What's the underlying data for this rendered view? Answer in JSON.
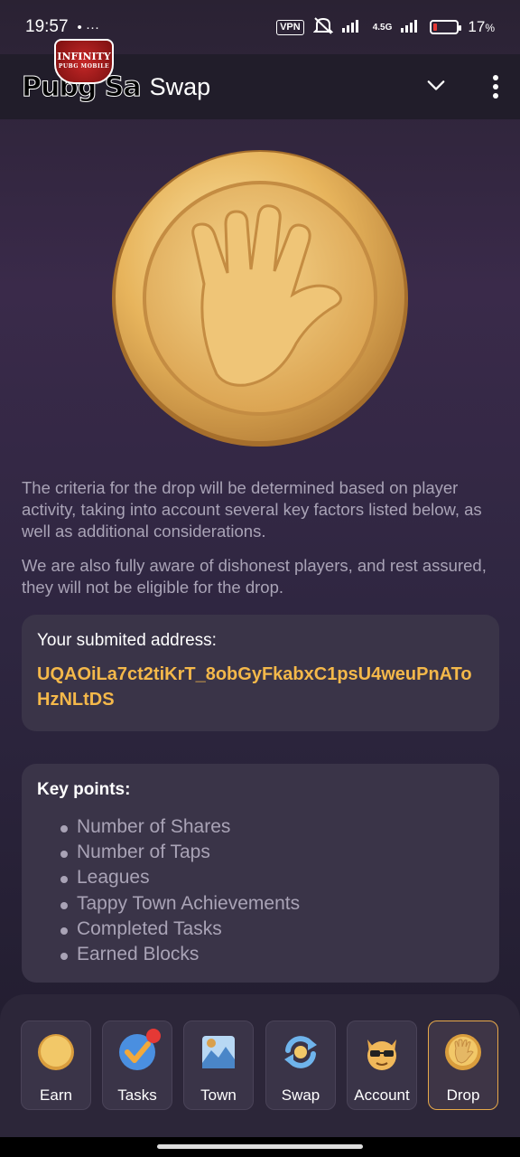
{
  "status": {
    "time": "19:57",
    "extra": "• ···",
    "vpn": "VPN",
    "network": "4.5G",
    "battery_percent": "17",
    "battery_suffix": "%",
    "battery_level": 0.17
  },
  "header": {
    "logo_text": "Pubg Sa",
    "logo_badge_line1": "INFINITY",
    "logo_badge_line2": "PUBG MOBILE",
    "title": "Swap",
    "back_glyph": "‹"
  },
  "main": {
    "paragraph1": "The criteria for the drop will be determined based on player activity, taking into account several key factors listed below, as well as additional considerations.",
    "paragraph2": "We are also fully aware of dishonest players, and rest assured, they will not be eligible for the drop.",
    "address_label": "Your submited address:",
    "address_value": "UQAOiLa7ct2tiKrT_8obGyFkabxC1psU4weuPnAToHzNLtDS",
    "key_points_title": "Key points:",
    "key_points": [
      "Number of Shares",
      "Number of Taps",
      "Leagues",
      "Tappy Town Achievements",
      "Completed Tasks",
      "Earned Blocks"
    ]
  },
  "nav": {
    "items": [
      {
        "label": "Earn",
        "icon": "coin-icon"
      },
      {
        "label": "Tasks",
        "icon": "checkmark-icon"
      },
      {
        "label": "Town",
        "icon": "town-icon"
      },
      {
        "label": "Swap",
        "icon": "swap-icon"
      },
      {
        "label": "Account",
        "icon": "cat-icon"
      },
      {
        "label": "Drop",
        "icon": "hand-coin-icon",
        "active": true
      }
    ]
  },
  "colors": {
    "accent": "#f4b84a",
    "active_border": "#e7a94a",
    "card_bg": "#3a3448"
  }
}
